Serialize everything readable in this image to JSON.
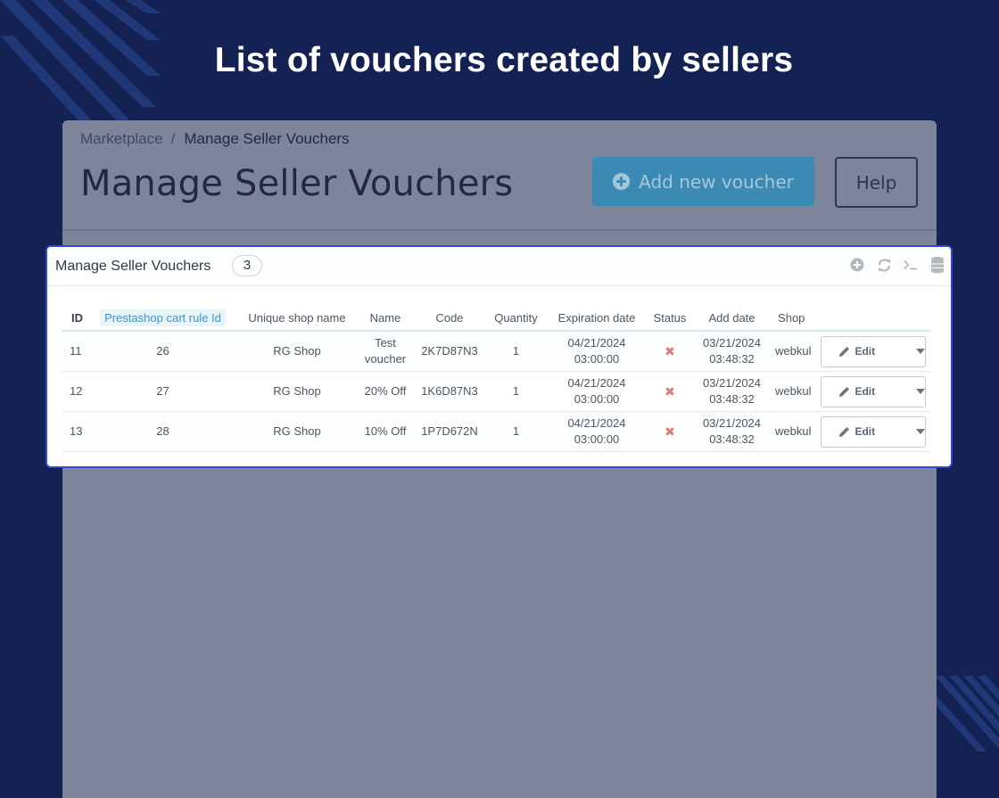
{
  "banner": {
    "heading": "List of vouchers created by sellers"
  },
  "admin": {
    "breadcrumb": {
      "root": "Marketplace",
      "separator": "/",
      "current": "Manage Seller Vouchers"
    },
    "title": "Manage Seller Vouchers",
    "add_button_label": "Add new voucher",
    "help_button_label": "Help"
  },
  "panel": {
    "title": "Manage Seller Vouchers",
    "count": "3",
    "tool_icons": [
      "add-icon",
      "refresh-icon",
      "sql-query-icon",
      "database-export-icon"
    ]
  },
  "table": {
    "columns": [
      "ID",
      "Prestashop cart rule Id",
      "Unique shop name",
      "Name",
      "Code",
      "Quantity",
      "Expiration date",
      "Status",
      "Add date",
      "Shop"
    ],
    "rows": [
      {
        "id": "11",
        "cart_rule_id": "26",
        "shop_name": "RG Shop",
        "name_l1": "Test",
        "name_l2": "voucher",
        "code": "2K7D87N3",
        "quantity": "1",
        "exp_date": "04/21/2024",
        "exp_time": "03:00:00",
        "status_icon": "disabled-x-icon",
        "add_date": "03/21/2024",
        "add_time": "03:48:32",
        "shop": "webkul",
        "edit_label": "Edit"
      },
      {
        "id": "12",
        "cart_rule_id": "27",
        "shop_name": "RG Shop",
        "name_l1": "20% Off",
        "name_l2": "",
        "code": "1K6D87N3",
        "quantity": "1",
        "exp_date": "04/21/2024",
        "exp_time": "03:00:00",
        "status_icon": "disabled-x-icon",
        "add_date": "03/21/2024",
        "add_time": "03:48:32",
        "shop": "webkul",
        "edit_label": "Edit"
      },
      {
        "id": "13",
        "cart_rule_id": "28",
        "shop_name": "RG Shop",
        "name_l1": "10% Off",
        "name_l2": "",
        "code": "1P7D672N",
        "quantity": "1",
        "exp_date": "04/21/2024",
        "exp_time": "03:00:00",
        "status_icon": "disabled-x-icon",
        "add_date": "03/21/2024",
        "add_time": "03:48:32",
        "shop": "webkul",
        "edit_label": "Edit"
      }
    ]
  },
  "colors": {
    "background": "#132153",
    "panel_border": "#3446d2",
    "add_button": "#3b8ab4",
    "status_disabled": "#e07a7a"
  }
}
